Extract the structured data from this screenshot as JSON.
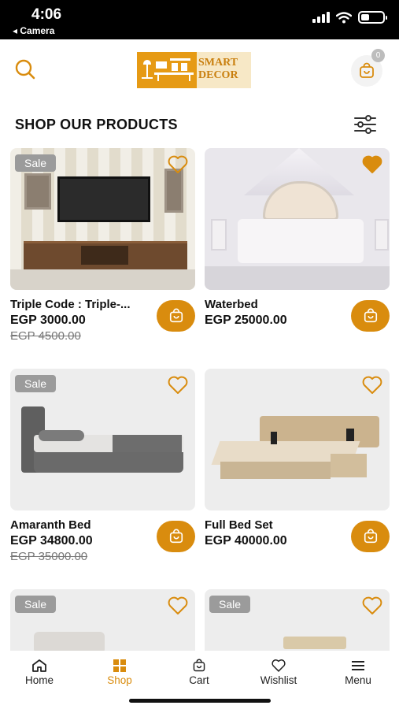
{
  "status_bar": {
    "time": "4:06",
    "back_label": "◂ Camera"
  },
  "header": {
    "logo_line1": "SMART",
    "logo_line2": "DECOR",
    "cart_count": "0"
  },
  "section": {
    "title": "SHOP OUR PRODUCTS"
  },
  "products": [
    {
      "title": "Triple Code : Triple-...",
      "price": "EGP 3000.00",
      "old_price": "EGP 4500.00",
      "sale_label": "Sale",
      "favorited": false
    },
    {
      "title": "Waterbed",
      "price": "EGP 25000.00",
      "old_price": "",
      "sale_label": "",
      "favorited": true
    },
    {
      "title": "Amaranth Bed",
      "price": "EGP 34800.00",
      "old_price": "EGP 35000.00",
      "sale_label": "Sale",
      "favorited": false
    },
    {
      "title": "Full Bed Set",
      "price": "EGP 40000.00",
      "old_price": "",
      "sale_label": "",
      "favorited": false
    },
    {
      "title": "",
      "price": "",
      "old_price": "",
      "sale_label": "Sale",
      "favorited": false
    },
    {
      "title": "",
      "price": "",
      "old_price": "",
      "sale_label": "Sale",
      "favorited": false
    }
  ],
  "nav": {
    "home": "Home",
    "shop": "Shop",
    "cart": "Cart",
    "wishlist": "Wishlist",
    "menu": "Menu"
  },
  "colors": {
    "accent": "#D98C0E",
    "sale_badge": "#9B9B9B"
  }
}
